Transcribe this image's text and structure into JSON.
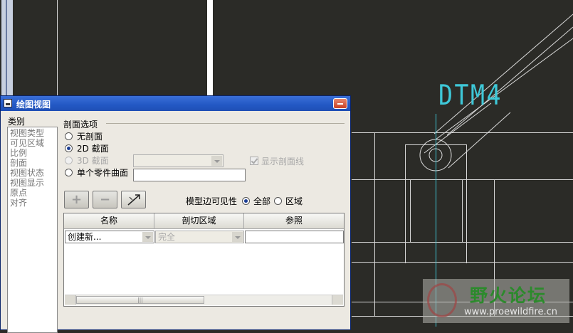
{
  "colors": {
    "canvas_bg": "#2b2b27",
    "cad_line": "#d8d8d8",
    "datum_cyan": "#3ec8d8",
    "dialog_bg": "#ece9e2",
    "titlebar": "#2358c4"
  },
  "canvas": {
    "datum_label": "DTM4"
  },
  "dialog": {
    "title": "绘图视图",
    "category_label": "类别",
    "categories": [
      "视图类型",
      "可见区域",
      "比例",
      "剖面",
      "视图状态",
      "视图显示",
      "原点",
      "对齐"
    ],
    "section_options": {
      "group_title": "剖面选项",
      "options": [
        {
          "label": "无剖面",
          "selected": false,
          "enabled": true
        },
        {
          "label": "2D 截面",
          "selected": true,
          "enabled": true
        },
        {
          "label": "3D 截面",
          "selected": false,
          "enabled": false
        },
        {
          "label": "单个零件曲面",
          "selected": false,
          "enabled": true
        }
      ],
      "show_section_line_label": "显示剖面线",
      "show_section_line_checked": true
    },
    "toolbar": {
      "add_icon": "plus-icon",
      "remove_icon": "minus-icon",
      "flip_icon": "flip-arrow-icon"
    },
    "edge_visibility": {
      "label": "模型边可见性",
      "options": [
        {
          "label": "全部",
          "selected": true
        },
        {
          "label": "区域",
          "selected": false
        }
      ]
    },
    "table": {
      "headers": [
        "名称",
        "剖切区域",
        "参照"
      ],
      "row": {
        "name": "创建新...",
        "region": "完全",
        "reference": ""
      }
    }
  },
  "watermark": {
    "title": "野火论坛",
    "url": "www.proewildfire.cn"
  }
}
